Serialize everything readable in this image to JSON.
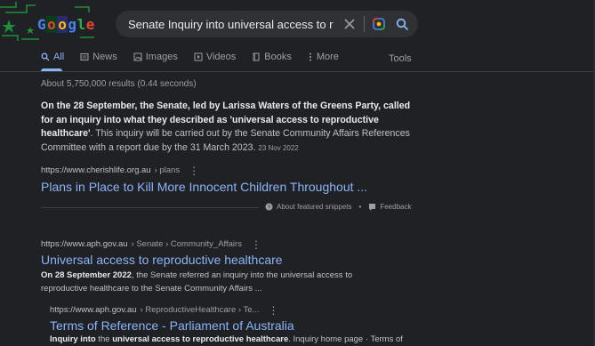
{
  "logo": {
    "text": "Google",
    "colors": [
      "#4285f4",
      "#ea4335",
      "#fbbc05",
      "#4285f4",
      "#34a853",
      "#ea4335"
    ]
  },
  "search": {
    "value": "Senate Inquiry into universal access to reproductive h",
    "placeholder": ""
  },
  "tabs": [
    {
      "label": "All",
      "icon": "search-icon"
    },
    {
      "label": "News",
      "icon": "news-icon"
    },
    {
      "label": "Images",
      "icon": "image-icon"
    },
    {
      "label": "Videos",
      "icon": "video-icon"
    },
    {
      "label": "Books",
      "icon": "book-icon"
    },
    {
      "label": "More",
      "icon": "more-vert-icon"
    }
  ],
  "tools_label": "Tools",
  "result_stats": "About 5,750,000 results (0.44 seconds)",
  "featured": {
    "bold_text": "On the 28 September, the Senate, led by Larissa Waters of the Greens Party, called for an inquiry into what they described as 'universal access to reproductive healthcare'",
    "normal_text": ". This inquiry will be carried out by the Senate Community Affairs References Committee with a report due by the 31 March 2023.",
    "date": "23 Nov 2022",
    "cite_domain": "https://www.cherishlife.org.au",
    "cite_path": "› plans",
    "title": "Plans in Place to Kill More Innocent Children Throughout ...",
    "about_label": "About featured snippets",
    "separator": "•",
    "feedback_label": "Feedback"
  },
  "results": [
    {
      "cite_domain": "https://www.aph.gov.au",
      "cite_path": "› Senate › Community_Affairs",
      "title": "Universal access to reproductive healthcare",
      "desc_bold": "On 28 September 2022",
      "desc_rest": ", the Senate referred an inquiry into the universal access to reproductive healthcare to the Senate Community Affairs ..."
    },
    {
      "cite_domain": "https://www.aph.gov.au",
      "cite_path": "› ReproductiveHealthcare › Te...",
      "title": "Terms of Reference - Parliament of Australia",
      "desc_bold1": "Inquiry into",
      "desc_mid": " the ",
      "desc_bold2": "universal access to reproductive healthcare",
      "desc_rest": ". Inquiry home page · Terms of"
    }
  ],
  "colors": {
    "background": "#202124",
    "link": "#8ab4f8",
    "text": "#bdc1c6",
    "muted": "#9aa0a6"
  }
}
